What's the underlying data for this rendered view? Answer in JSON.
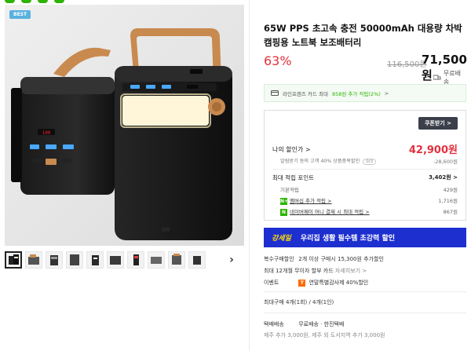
{
  "badge": "BEST",
  "product": {
    "title": "65W PPS 초고속 충전 50000mAh 대용량 차박 캠핑용 노트북 보조배터리",
    "discount": "63%",
    "original_price": "116,500원",
    "sale_price": "71,500원",
    "shipping": "무료배송"
  },
  "card_banner": {
    "prefix": "라인프렌즈 카드 최대",
    "highlight": "858원 추가 적립(2%)",
    "chevron": ">"
  },
  "benefits": {
    "coupon_button": "쿠폰받기 >",
    "my_price_label": "나의 할인가 >",
    "my_price_value": "42,900원",
    "alarm_text": "알림받기 동의 고객 40% 상품중복할인",
    "alarm_pill": "0/3",
    "alarm_value": "-28,600원",
    "max_point_label": "최대 적립 포인트",
    "max_point_value": "3,402원 >",
    "basic_label": "기본적립",
    "basic_value": "429원",
    "membership_badge": "N+",
    "membership_label": "멤버십 추가 적립 >",
    "membership_value": "1,716원",
    "naverpay_badge": "N",
    "naverpay_label": "네이버페이 머니 결제 시 최대 적립 >",
    "naverpay_value": "867원"
  },
  "promo": {
    "logo": "강세일",
    "text": "우리집 생활 필수템 초강력 할인"
  },
  "info": {
    "multi_label": "복수구매할인",
    "multi_value": "2개 이상 구매시 15,300원 추가할인",
    "installment_label": "최대 12개월 무이자 할부 카드",
    "installment_link": "자세히보기 >",
    "event_label": "이벤트",
    "event_badge": "T",
    "event_value": "연말특별감사제 40%할인",
    "max_purchase": "최대구매 4개(1회) / 4개(1인)",
    "delivery_label": "택배배송",
    "delivery_free": "무료배송 · 한진택배",
    "delivery_extra": "제주 추가 3,000원, 제주 외 도서지역 추가 3,000원"
  },
  "icons": {
    "next": "›",
    "truck": "truck-icon",
    "card": "card-icon"
  },
  "colors": {
    "sale_red": "#e5303d",
    "naver_green": "#2db400",
    "promo_blue": "#1e2fd0",
    "promo_yellow": "#ffde00",
    "badge_blue": "#5ab1e0"
  }
}
